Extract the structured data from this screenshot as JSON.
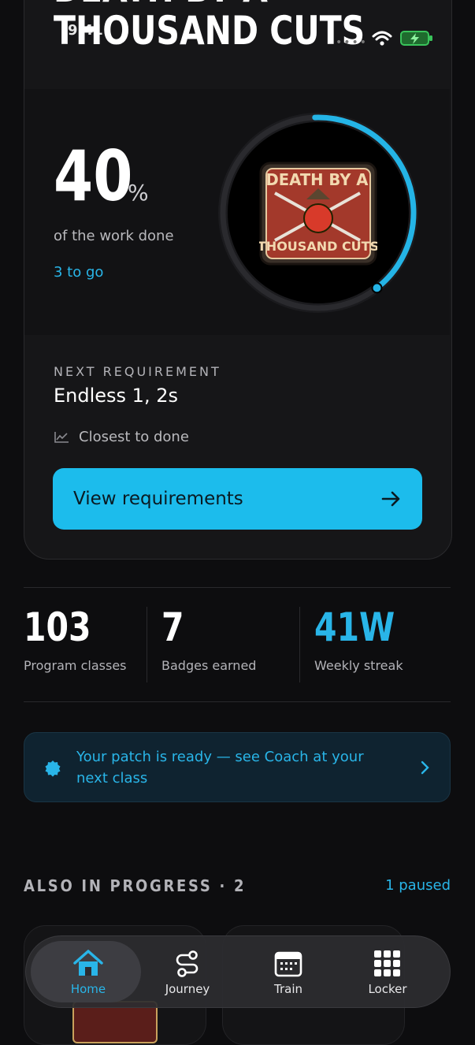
{
  "status_bar": {
    "time": "9:41"
  },
  "hero": {
    "title_line1": "DEATH BY A",
    "title_line2": "THOUSAND CUTS",
    "percent": "40",
    "percent_sign": "%",
    "progress_fraction": 0.4,
    "work_label": "of the work done",
    "to_go": "3 to go",
    "badge_top": "DEATH BY A",
    "badge_bottom": "THOUSAND CUTS"
  },
  "requirement": {
    "label": "NEXT REQUIREMENT",
    "value": "Endless 1, 2s",
    "closest": "Closest to done",
    "button_label": "View requirements"
  },
  "stats": [
    {
      "value": "103",
      "label": "Program classes"
    },
    {
      "value": "7",
      "label": "Badges earned"
    },
    {
      "value": "41W",
      "label": "Weekly streak"
    }
  ],
  "banner": {
    "text": "Your patch is ready — see Coach at your next class"
  },
  "also": {
    "label": "ALSO IN PROGRESS · 2",
    "paused": "1 paused"
  },
  "nav": [
    {
      "label": "Home",
      "icon": "home-icon"
    },
    {
      "label": "Journey",
      "icon": "journey-icon"
    },
    {
      "label": "Train",
      "icon": "calendar-icon"
    },
    {
      "label": "Locker",
      "icon": "grid-icon"
    }
  ],
  "colors": {
    "accent": "#1cbcec",
    "background": "#0d0d0f",
    "card": "#161618"
  }
}
